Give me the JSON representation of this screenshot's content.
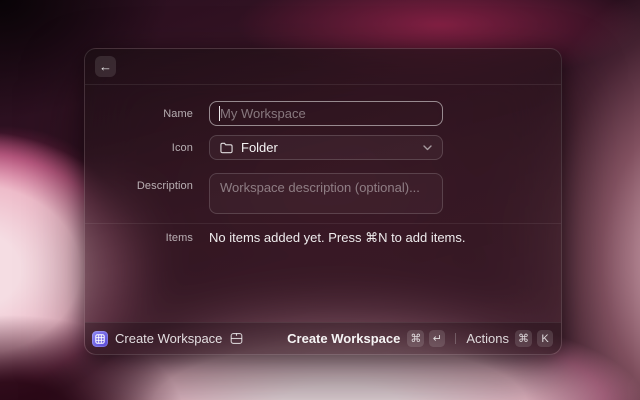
{
  "window": {
    "back_icon": "←"
  },
  "form": {
    "name": {
      "label": "Name",
      "placeholder": "My Workspace"
    },
    "icon": {
      "label": "Icon",
      "value": "Folder"
    },
    "description": {
      "label": "Description",
      "placeholder": "Workspace description (optional)..."
    },
    "items": {
      "label": "Items",
      "empty_text": "No items added yet. Press ⌘N to add items."
    }
  },
  "footer": {
    "app_title": "Create Workspace",
    "submit": {
      "label": "Create Workspace",
      "keys": [
        "⌘",
        "↵"
      ]
    },
    "actions": {
      "label": "Actions",
      "keys": [
        "⌘",
        "K"
      ]
    }
  },
  "colors": {
    "accent_icon_start": "#8d87f2",
    "accent_icon_end": "#5746d6",
    "focus_ring": "rgba(255,255,255,0.5)",
    "bg_highlight_pink": "#f3c3d1",
    "bg_base_maroon": "#2c1020"
  }
}
